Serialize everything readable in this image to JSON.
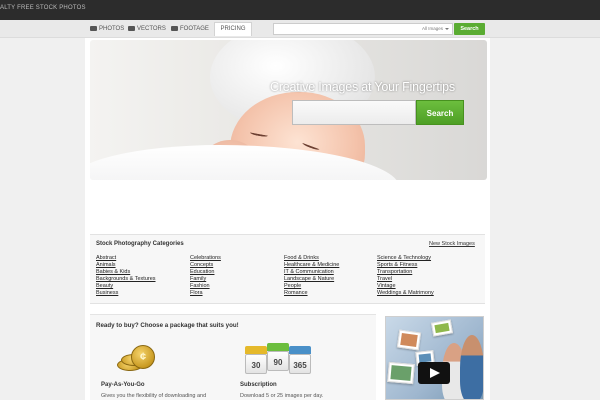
{
  "topbar": {
    "brand": "ALTY FREE STOCK PHOTOS"
  },
  "nav": {
    "tabs": [
      {
        "label": "PHOTOS",
        "icon": "camera-icon"
      },
      {
        "label": "VECTORS",
        "icon": "vector-icon"
      },
      {
        "label": "FOOTAGE",
        "icon": "film-icon"
      },
      {
        "label": "PRICING"
      }
    ],
    "search": {
      "select_value": "All Images",
      "button": "Search"
    }
  },
  "hero": {
    "title": "Creative Images at Your Fingertips",
    "search_button": "Search"
  },
  "categories": {
    "title": "Stock Photography Categories",
    "new_link": "New Stock Images",
    "columns": [
      [
        "Abstract",
        "Animals",
        "Babies & Kids",
        "Backgrounds & Textures",
        "Beauty",
        "Business"
      ],
      [
        "Celebrations",
        "Concepts",
        "Education",
        "Family",
        "Fashion",
        "Flora"
      ],
      [
        "Food & Drinks",
        "Healthcare & Medicine",
        "IT & Communication",
        "Landscape & Nature",
        "People",
        "Romance"
      ],
      [
        "Science & Technology",
        "Sports & Fitness",
        "Transportation",
        "Travel",
        "Vintage",
        "Weddings & Matrimony"
      ]
    ]
  },
  "packages": {
    "title": "Ready to buy? Choose a package that suits you!",
    "items": [
      {
        "name": "Pay-As-You-Go",
        "desc": "Gives you the flexibility of downloading and"
      },
      {
        "name": "Subscription",
        "desc": "Download 5 or 25 images per day."
      }
    ],
    "calendar_numbers": [
      "30",
      "90",
      "365"
    ]
  },
  "colors": {
    "accent_green": "#5aac32",
    "topbar": "#2c2c2c"
  }
}
